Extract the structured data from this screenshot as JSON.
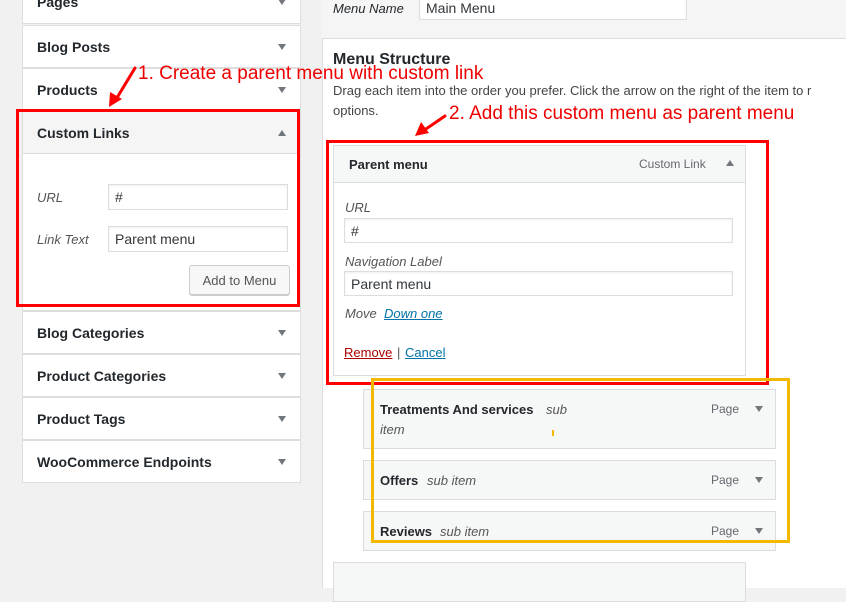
{
  "sidebar": {
    "items": [
      {
        "label": "Pages"
      },
      {
        "label": "Blog Posts"
      },
      {
        "label": "Products"
      },
      {
        "label": "Custom Links"
      },
      {
        "label": "Blog Categories"
      },
      {
        "label": "Product Categories"
      },
      {
        "label": "Product Tags"
      },
      {
        "label": "WooCommerce Endpoints"
      }
    ],
    "custom_links": {
      "url_label": "URL",
      "url_value": "#",
      "link_text_label": "Link Text",
      "link_text_value": "Parent menu",
      "add_button": "Add to Menu"
    }
  },
  "main": {
    "menu_name_label": "Menu Name",
    "menu_name_value": "Main Menu",
    "structure_title": "Menu Structure",
    "structure_desc_line1": "Drag each item into the order you prefer. Click the arrow on the right of the item to r",
    "structure_desc_line2": "options.",
    "parent_item": {
      "title": "Parent menu",
      "type": "Custom Link",
      "url_label": "URL",
      "url_value": "#",
      "nav_label": "Navigation Label",
      "nav_value": "Parent menu",
      "move_label": "Move",
      "move_link": "Down one",
      "remove": "Remove",
      "separator": "|",
      "cancel": "Cancel"
    },
    "sub_items": [
      {
        "title": "Treatments And services",
        "sub": "sub",
        "sub2": "item",
        "type": "Page"
      },
      {
        "title": "Offers",
        "sub": "sub item",
        "type": "Page"
      },
      {
        "title": "Reviews",
        "sub": "sub item",
        "type": "Page"
      }
    ]
  },
  "annotations": {
    "note1": "1. Create a parent menu with custom link",
    "note2": "2. Add this custom menu as parent menu"
  },
  "colors": {
    "annotation_red": "#ff0000",
    "annotation_yellow": "#f5b800",
    "link_blue": "#0073aa",
    "remove_red": "#a00"
  }
}
